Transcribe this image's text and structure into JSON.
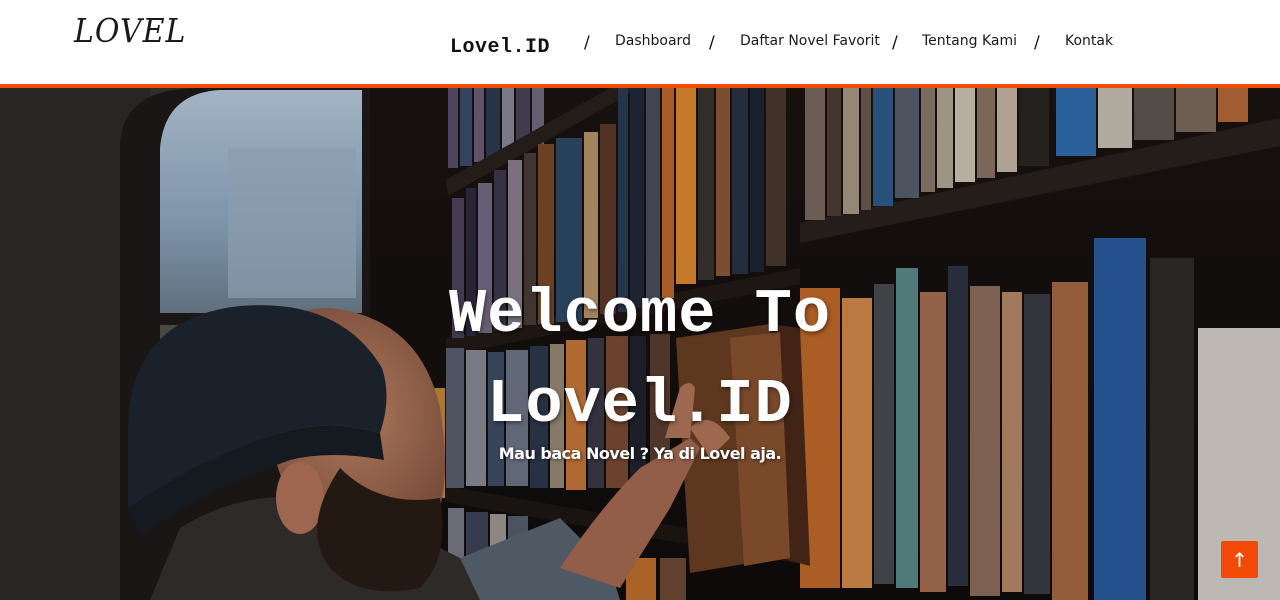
{
  "header": {
    "logo_text": "LOVEL",
    "brand": "Lovel.ID",
    "separator": "/",
    "nav": [
      {
        "label": "Dashboard"
      },
      {
        "label": "Daftar Novel Favorit"
      },
      {
        "label": "Tentang Kami"
      },
      {
        "label": "Kontak"
      }
    ]
  },
  "hero": {
    "title_line1": "Welcome To",
    "title_line2": "Lovel.ID",
    "subtitle": "Mau baca Novel ? Ya di Lovel aja."
  },
  "back_to_top": {
    "icon": "arrow-up-icon",
    "glyph": "↑"
  },
  "colors": {
    "accent": "#f24a06",
    "nav_bg": "#ffffff",
    "hero_text": "#ffffff"
  }
}
